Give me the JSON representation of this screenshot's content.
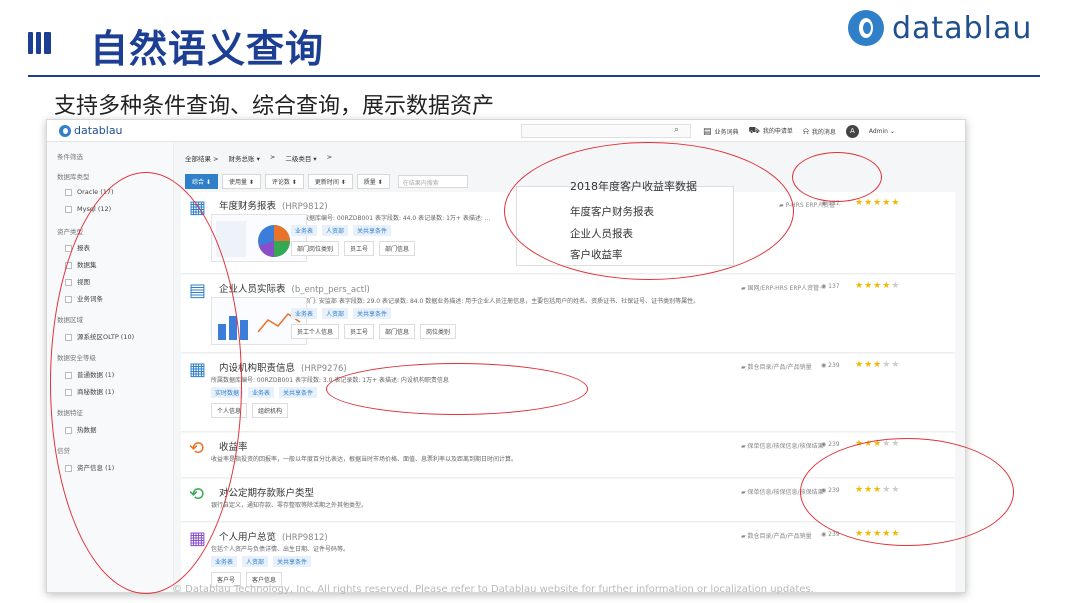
{
  "slide": {
    "title": "自然语义查询",
    "subtitle": "支持多种条件查询、综合查询，展示数据资产",
    "logo": "datablau",
    "footer": "© Datablau Technology, Inc. All rights reserved. Please refer to Datablau website for further information or localization updates."
  },
  "app": {
    "logo": "datablau",
    "topbar": {
      "items": [
        "业务词典",
        "我的申请单",
        "我的消息"
      ],
      "avatar": "A",
      "user": "Admin"
    },
    "sidebar": {
      "title": "条件筛选",
      "rows": [
        {
          "text": "数据库类型",
          "kind": "head"
        },
        {
          "text": "Oracle  (17)",
          "kind": "sub"
        },
        {
          "text": "Mysql  (12)",
          "kind": "sub"
        },
        {
          "text": "资产类型",
          "kind": "head"
        },
        {
          "text": "报表",
          "kind": "sub"
        },
        {
          "text": "数据集",
          "kind": "sub"
        },
        {
          "text": "视图",
          "kind": "sub"
        },
        {
          "text": "业务词条",
          "kind": "sub"
        },
        {
          "text": "数据区域",
          "kind": "head"
        },
        {
          "text": "源系统区OLTP  (10)",
          "kind": "sub"
        },
        {
          "text": "数据安全等级",
          "kind": "head"
        },
        {
          "text": "普通数据  (1)",
          "kind": "sub"
        },
        {
          "text": "商秘数据  (1)",
          "kind": "sub"
        },
        {
          "text": "数据特征",
          "kind": "head"
        },
        {
          "text": "热数据",
          "kind": "sub"
        },
        {
          "text": "信贷",
          "kind": "head"
        },
        {
          "text": "资产信息  (1)",
          "kind": "sub"
        }
      ]
    },
    "breadcrumb": [
      "全部结果 >",
      "财务总账 ▾",
      ">",
      "二级类目 ▾",
      ">"
    ],
    "filters": [
      "综合 ⬇",
      "使用量 ⬍",
      "评论数 ⬍",
      "更新时间 ⬍",
      "质量 ⬍"
    ],
    "filter_placeholder": "在结果内搜索",
    "popup": {
      "title": "2018年度客户收益率数据",
      "items": [
        "年度客户财务报表",
        "企业人员报表",
        "客户收益率"
      ]
    },
    "cards": [
      {
        "title": "年度财务报表",
        "code": "(HRP9812)",
        "desc": "所属数据库编号: 00RZDB001  表字段数: 44.0  表记录数: 1万+  表描述: ...",
        "tags": [
          "业务表",
          "人资部",
          "关共享条件"
        ],
        "btags": [
          "部门岗位类别",
          "员工号",
          "部门信息"
        ],
        "meta": "P-HRS ERP人资管···",
        "views": "137",
        "stars": 5
      },
      {
        "title": "企业人员实际表",
        "code": "(b_entp_pers_actl)",
        "desc": "管理部门: 安监部  表字段数: 29.0  表记录数: 84.0  数据业务描述: 用于企业人员注册信息，主要包括用户的姓名、资质证书、社保证号、证书类别等属性。",
        "tags": [
          "业务表",
          "人资部",
          "关共享条件"
        ],
        "btags": [
          "员工个人信息",
          "员工号",
          "部门信息",
          "岗位类别"
        ],
        "meta": "国网/ERP-HRS ERP人资管···",
        "views": "137",
        "stars": 4
      },
      {
        "title": "内设机构职责信息",
        "code": "(HRP9276)",
        "desc": "所属数据库编号: 00RZDB001  表字段数: 3.0  表记录数: 1万+  表描述: 内设机构职责信息",
        "tags": [
          "实时数据",
          "业务表",
          "关共享条件"
        ],
        "btags": [
          "个人信息",
          "组织机构"
        ],
        "meta": "数仓目录/产品/产品销量",
        "views": "239",
        "stars": 3
      },
      {
        "title": "收益率",
        "code": "",
        "desc": "收益率是指投资的回报率，一般以年度百分比表达，根据当时市场价格、面值、息票利率以及距离到期日时间计算。",
        "tags": [],
        "btags": [],
        "meta": "保单信息/核保信息/核保结果",
        "views": "239",
        "stars": 3
      },
      {
        "title": "对公定期存款账户类型",
        "code": "",
        "desc": "银行自定义，通知存款、零存整取等除活期之外其他类型。",
        "tags": [],
        "btags": [],
        "meta": "保单信息/核保信息/核保结果",
        "views": "239",
        "stars": 3
      },
      {
        "title": "个人用户总览",
        "code": "(HRP9812)",
        "desc": "包括个人资产与负债详情、出生日期、证件号码等。",
        "tags": [
          "业务表",
          "人资部",
          "关共享条件"
        ],
        "btags": [
          "客户号",
          "客户信息"
        ],
        "meta": "数仓目录/产品/产品销量",
        "views": "239",
        "stars": 5
      }
    ]
  },
  "colors": {
    "title_blue": "#1c3f94",
    "accent_blue": "#2f80c8",
    "annotation_red": "#e0323a",
    "star": "#f3b700"
  }
}
